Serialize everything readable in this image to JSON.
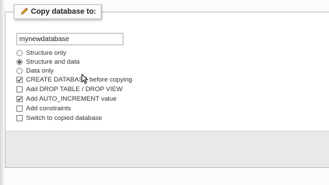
{
  "fieldset": {
    "legend": "Copy database to:",
    "legend_icon": "pencil-icon"
  },
  "db_name_input": {
    "value": "mynewdatabase"
  },
  "radio_options": [
    {
      "label": "Structure only",
      "checked": false
    },
    {
      "label": "Structure and data",
      "checked": true
    },
    {
      "label": "Data only",
      "checked": false
    }
  ],
  "checkbox_options": [
    {
      "label": "CREATE DATABASE before copying",
      "checked": true
    },
    {
      "label": "Add DROP TABLE / DROP VIEW",
      "checked": false
    },
    {
      "label": "Add AUTO_INCREMENT value",
      "checked": true
    },
    {
      "label": "Add constraints",
      "checked": false
    },
    {
      "label": "Switch to copied database",
      "checked": false
    }
  ]
}
